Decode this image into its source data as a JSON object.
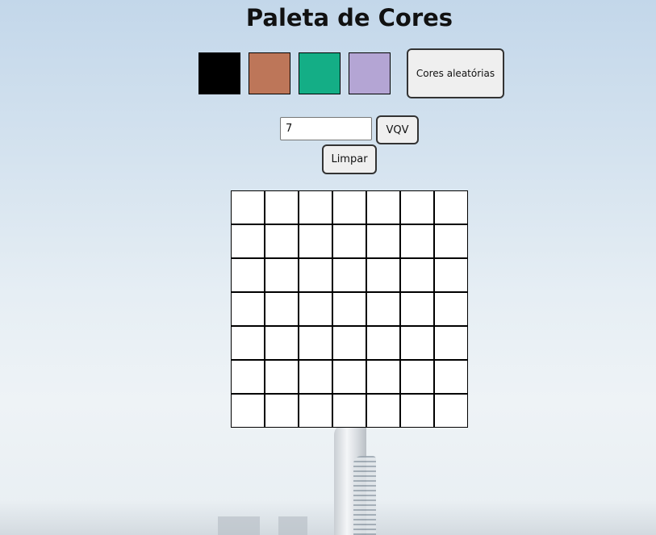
{
  "title": "Paleta de Cores",
  "palette": {
    "colors": [
      "#000000",
      "#bd7659",
      "#14ae86",
      "#b4a5d4"
    ]
  },
  "random_button": {
    "label": "Cores aleatórias"
  },
  "board_size_input": {
    "value": "7"
  },
  "generate_button": {
    "label": "VQV"
  },
  "clear_button": {
    "label": "Limpar"
  },
  "board": {
    "rows": 7,
    "columns": 7,
    "cell_color": "#ffffff"
  }
}
